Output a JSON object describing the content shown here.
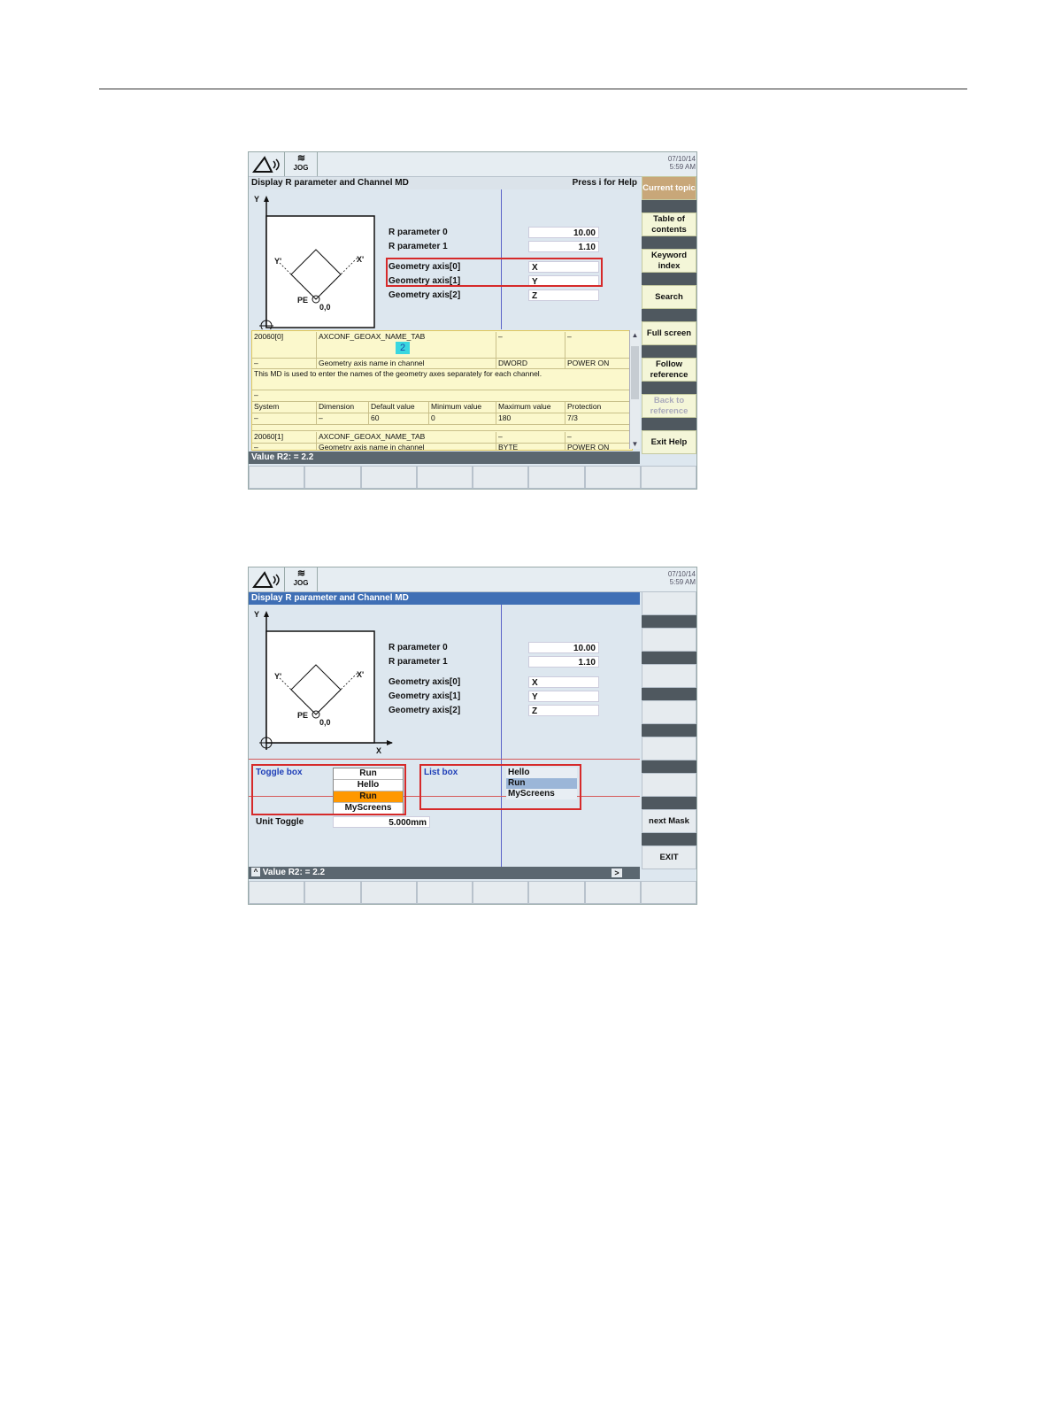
{
  "common": {
    "jog": "JOG",
    "date": "07/10/14",
    "time": "5:59 AM",
    "title": "Display R parameter and Channel MD",
    "diagram": {
      "y": "Y",
      "x": "X",
      "y_prime": "Y'",
      "x_prime": "X'",
      "pe": "PE",
      "origin": "0,0"
    },
    "fields": [
      {
        "label": "R parameter 0",
        "value": "10.00"
      },
      {
        "label": "R parameter 1",
        "value": "1.10"
      },
      {
        "label": "Geometry axis[0]",
        "value": "X"
      },
      {
        "label": "Geometry axis[1]",
        "value": "Y"
      },
      {
        "label": "Geometry axis[2]",
        "value": "Z"
      }
    ],
    "status": "Value R2: = 2.2"
  },
  "screen1": {
    "help_hint": "Press i for Help",
    "softkeys": [
      {
        "label": "Current topic",
        "state": "active"
      },
      {
        "label": "Table of contents",
        "state": "normal"
      },
      {
        "label": "Keyword index",
        "state": "normal"
      },
      {
        "label": "Search",
        "state": "normal"
      },
      {
        "label": "Full screen",
        "state": "normal"
      },
      {
        "label": "Follow reference",
        "state": "normal"
      },
      {
        "label": "Back to reference",
        "state": "disabled"
      },
      {
        "label": "Exit Help",
        "state": "normal"
      }
    ],
    "badge": "2",
    "md": {
      "r1": [
        "20060[0]",
        "AXCONF_GEOAX_NAME_TAB",
        "–",
        "–"
      ],
      "r2": [
        "–",
        "Geometry axis name in channel",
        "DWORD",
        "POWER ON"
      ],
      "desc": "This MD is used to enter the names of the geometry axes separately for each channel.",
      "r4": [
        "–"
      ],
      "headers": [
        "System",
        "Dimension",
        "Default value",
        "Minimum value",
        "Maximum value",
        "Protection"
      ],
      "values": [
        "–",
        "–",
        "60",
        "0",
        "180",
        "7/3"
      ],
      "r7": [
        "20060[1]",
        "AXCONF_GEOAX_NAME_TAB",
        "–",
        "–"
      ],
      "r8": [
        "–",
        "Geometry axis name in channel",
        "BYTE",
        "POWER ON"
      ]
    }
  },
  "screen2": {
    "toggle_label": "Toggle box",
    "toggle_options": [
      "Run",
      "Hello",
      "Run",
      "MyScreens"
    ],
    "toggle_selected_index": 2,
    "list_label": "List box",
    "list_options": [
      "Hello",
      "Run",
      "MyScreens"
    ],
    "list_selected_index": 1,
    "unit_label": "Unit Toggle",
    "unit_value": "5.000mm",
    "softkeys": [
      "",
      "",
      "",
      "",
      "",
      "",
      "next Mask",
      "EXIT"
    ],
    "status_prefix": "^",
    "status_arrow": ">"
  }
}
